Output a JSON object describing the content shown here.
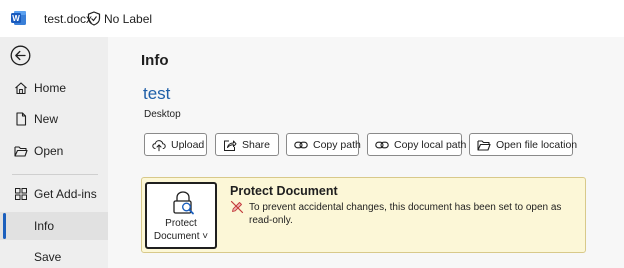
{
  "titlebar": {
    "file_name": "test.docx",
    "label": "No Label"
  },
  "sidebar": {
    "items": [
      {
        "label": "Home",
        "icon": "home-icon"
      },
      {
        "label": "New",
        "icon": "new-doc-icon"
      },
      {
        "label": "Open",
        "icon": "folder-icon"
      },
      {
        "label": "Get Add-ins",
        "icon": "grid-icon"
      },
      {
        "label": "Info",
        "icon": ""
      },
      {
        "label": "Save",
        "icon": ""
      }
    ],
    "active": "Info"
  },
  "main": {
    "page_title": "Info",
    "doc_title": "test",
    "doc_location": "Desktop",
    "buttons": [
      {
        "label": "Upload",
        "icon": "upload-icon"
      },
      {
        "label": "Share",
        "icon": "share-icon"
      },
      {
        "label": "Copy path",
        "icon": "link-icon"
      },
      {
        "label": "Copy local path",
        "icon": "link-icon"
      },
      {
        "label": "Open file location",
        "icon": "folder-icon"
      }
    ],
    "protect": {
      "button_line1": "Protect",
      "button_line2": "Document ˅",
      "heading": "Protect Document",
      "message": "To prevent accidental changes, this document has been set to open as read-only."
    }
  },
  "colors": {
    "accent": "#1b5fbd",
    "doc_title": "#1f5fa8",
    "protect_bg": "#fcf7d7",
    "sidebar_bg": "#eeeeee"
  }
}
